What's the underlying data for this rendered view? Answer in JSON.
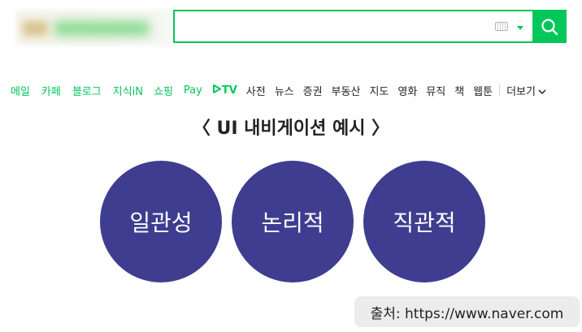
{
  "search": {
    "value": "",
    "placeholder": ""
  },
  "nav": {
    "items": [
      {
        "label": "메일",
        "tone": "green"
      },
      {
        "label": "카페",
        "tone": "green"
      },
      {
        "label": "블로그",
        "tone": "green"
      },
      {
        "label": "지식iN",
        "tone": "green"
      },
      {
        "label": "쇼핑",
        "tone": "green"
      },
      {
        "label": "Pay",
        "tone": "green"
      },
      {
        "label": "TV",
        "tone": "green"
      },
      {
        "label": "사전",
        "tone": "dark"
      },
      {
        "label": "뉴스",
        "tone": "dark"
      },
      {
        "label": "증권",
        "tone": "dark"
      },
      {
        "label": "부동산",
        "tone": "dark"
      },
      {
        "label": "지도",
        "tone": "dark"
      },
      {
        "label": "영화",
        "tone": "dark"
      },
      {
        "label": "뮤직",
        "tone": "dark"
      },
      {
        "label": "책",
        "tone": "dark"
      },
      {
        "label": "웹툰",
        "tone": "dark"
      }
    ],
    "more": "더보기"
  },
  "heading": "〈 UI 내비게이션 예시 〉",
  "circles": [
    "일관성",
    "논리적",
    "직관적"
  ],
  "source": "출처: https://www.naver.com",
  "colors": {
    "brand": "#03c75a",
    "circle": "#3f3d8f",
    "source_bg": "#ececec"
  },
  "icons": {
    "search": "magnifier-icon",
    "keyboard": "keyboard-icon",
    "dropdown": "caret-down-icon",
    "more": "chevron-down-icon",
    "tv": "play-triangle-icon"
  }
}
